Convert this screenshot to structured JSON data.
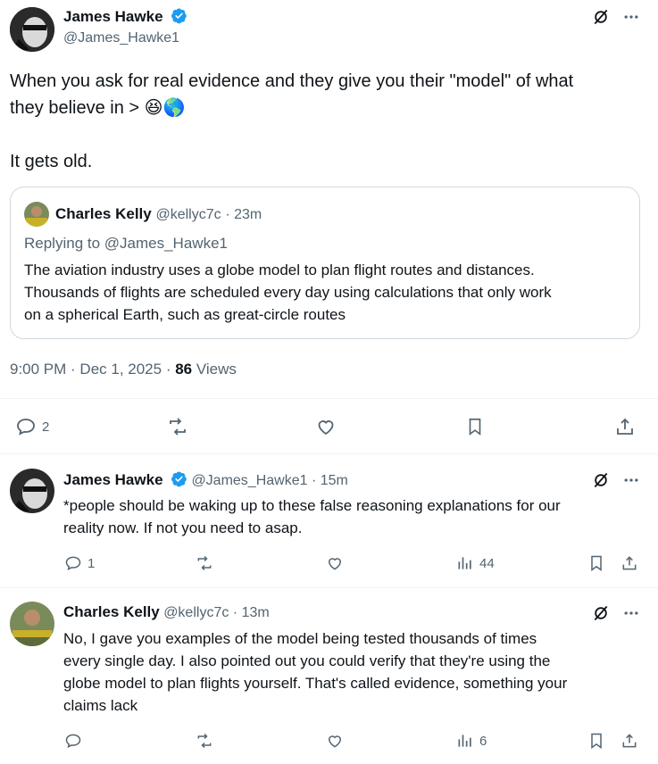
{
  "main_post": {
    "author_name": "James Hawke",
    "author_handle": "@James_Hawke1",
    "text_line1": "When you ask for real evidence and they give you their \"model\" of what",
    "text_line2": "they believe in >",
    "emoji": "😆🌎",
    "text_line3": "It gets old.",
    "quote": {
      "author_name": "Charles Kelly",
      "author_handle": "@kellyc7c",
      "time": "· 23m",
      "replying_to": "Replying to @James_Hawke1",
      "line1": "The aviation industry uses a globe model to plan flight routes and distances.",
      "line2": "Thousands of flights are scheduled every day using calculations that only work",
      "line3": "on a spherical Earth, such as great-circle routes"
    },
    "timestamp": "9:00 PM · Dec 1, 2025 ·",
    "views_count": "86",
    "views_label": "Views",
    "replies": "2"
  },
  "replies": [
    {
      "author_name": "James Hawke",
      "author_handle": "@James_Hawke1",
      "time": "· 15m",
      "line1": "*people should be waking up to these false reasoning explanations for our",
      "line2": "reality now.  If not you need to asap.",
      "reply_count": "1",
      "view_count": "44"
    },
    {
      "author_name": "Charles Kelly",
      "author_handle": "@kellyc7c",
      "time": "· 13m",
      "line1": "No, I gave you examples of the model being tested thousands of times",
      "line2": "every single day. I also pointed out you could verify that they're using the",
      "line3": "globe model to plan flights yourself. That's called evidence, something your",
      "line4": "claims lack",
      "view_count": "6"
    }
  ],
  "colors": {
    "verified": "#1d9bf0",
    "muted": "#536471",
    "border": "#cfd9de"
  }
}
